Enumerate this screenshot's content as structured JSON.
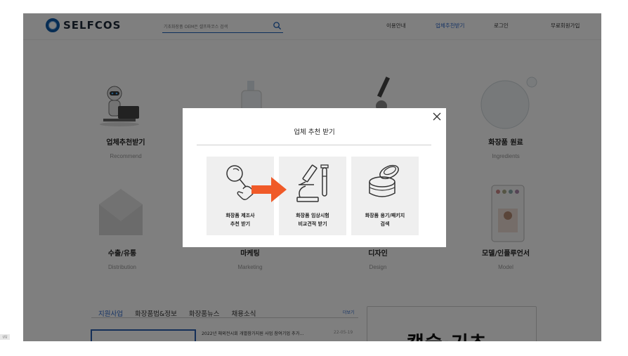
{
  "header": {
    "logo_text": "SELFCOS",
    "search_placeholder": "기초화장품 OEM은 셀프파코스 검색",
    "nav": [
      "이용안내",
      "업체추천받기",
      "로그인",
      "무료회원가입"
    ],
    "active_nav": "업체추천받기"
  },
  "categories": [
    {
      "title": "업체추천받기",
      "subtitle": "Recommend"
    },
    {
      "title": "화장품 원료",
      "subtitle": "Ingredients"
    },
    {
      "title": "수출/유통",
      "subtitle": "Distribution"
    },
    {
      "title": "마케팅",
      "subtitle": "Marketing"
    },
    {
      "title": "디자인",
      "subtitle": "Design"
    },
    {
      "title": "모델/인플루언서",
      "subtitle": "Model"
    }
  ],
  "news": {
    "tabs": [
      "지원사업",
      "화장품법&정보",
      "화장품뉴스",
      "채용소식"
    ],
    "more_label": "더보기",
    "first_item": "2022년 해외전시회 개별참가지원 사업 참여기업 추가...",
    "first_date": "22-05-19",
    "promo_text": "캡슐·기초"
  },
  "side_badge": "상담",
  "modal": {
    "title": "업체 추천 받기",
    "cards": [
      {
        "label": "화장품 제조사\n추천 받기",
        "icon": "magnifier-hand-icon"
      },
      {
        "label": "화장품 임상시험\n비교견적 받기",
        "icon": "microscope-icon"
      },
      {
        "label": "화장품 용기/패키지\n검색",
        "icon": "cosmetic-jar-icon"
      }
    ],
    "arrow_color": "#f05a28"
  },
  "colors": {
    "brand": "#0f5aa8",
    "accent": "#2b66c8",
    "overlay": "rgba(0,0,0,0.5)"
  }
}
